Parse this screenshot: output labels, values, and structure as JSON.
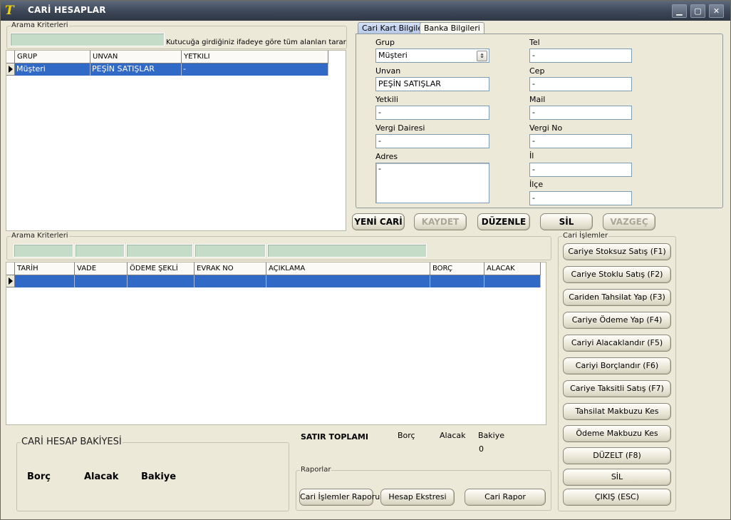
{
  "window": {
    "title": "CARİ HESAPLAR",
    "logo_text": "T",
    "controls": [
      "▁",
      "▢",
      "✕"
    ]
  },
  "search1": {
    "legend": "Arama Kriterleri",
    "hint": "Kutucuğa girdiğiniz ifadeye göre tüm alanları tarar"
  },
  "grid1": {
    "columns": [
      "GRUP",
      "UNVAN",
      "YETKILI"
    ],
    "row": [
      "Müşteri",
      "PEŞİN SATIŞLAR",
      "-"
    ]
  },
  "tabs": [
    "Cari Kart Bilgileri",
    "Banka Bilgileri"
  ],
  "form": {
    "grup_label": "Grup",
    "grup_value": "Müşteri",
    "combo_glyph": "⇕",
    "unvan_label": "Unvan",
    "unvan_value": "PEŞİN SATIŞLAR",
    "yetkili_label": "Yetkili",
    "yetkili_value": "-",
    "vergi_dairesi_label": "Vergi Dairesi",
    "vergi_dairesi_value": "-",
    "adres_label": "Adres",
    "adres_value": "-",
    "tel_label": "Tel",
    "tel_value": "-",
    "cep_label": "Cep",
    "cep_value": "-",
    "mail_label": "Mail",
    "mail_value": "-",
    "vergi_no_label": "Vergi No",
    "vergi_no_value": "-",
    "il_label": "İl",
    "il_value": "-",
    "ilce_label": "İlçe",
    "ilce_value": "-"
  },
  "actions": {
    "yeni": "YENİ CARİ",
    "kaydet": "KAYDET",
    "duzenle": "DÜZENLE",
    "sil": "SİL",
    "vazgec": "VAZGEÇ"
  },
  "search2": {
    "legend": "Arama Kriterleri"
  },
  "grid2": {
    "columns": [
      "TARİH",
      "VADE",
      "ÖDEME ŞEKLİ",
      "EVRAK NO",
      "AÇIKLAMA",
      "BORÇ",
      "ALACAK"
    ]
  },
  "cari_islemler": {
    "legend": "Cari İşlemler",
    "buttons": [
      "Cariye Stoksuz Satış (F1)",
      "Cariye Stoklu Satış (F2)",
      "Cariden Tahsilat Yap (F3)",
      "Cariye Ödeme Yap (F4)",
      "Cariyi Alacaklandır (F5)",
      "Cariyi Borçlandır (F6)",
      "Cariye Taksitli Satış (F7)",
      "Tahsilat Makbuzu Kes",
      "Ödeme Makbuzu Kes",
      "DÜZELT (F8)",
      "SİL",
      "ÇIKIŞ (ESC)"
    ]
  },
  "bakiye": {
    "legend": "CARİ HESAP BAKİYESİ",
    "borc": "Borç",
    "alacak": "Alacak",
    "bakiye": "Bakiye"
  },
  "satir_toplami": {
    "title": "SATIR TOPLAMI",
    "borc": "Borç",
    "alacak": "Alacak",
    "bakiye": "Bakiye",
    "bakiye_value": "0"
  },
  "raporlar": {
    "legend": "Raporlar",
    "buttons": [
      "Cari İşlemler Raporu",
      "Hesap Ekstresi",
      "Cari Rapor"
    ]
  }
}
